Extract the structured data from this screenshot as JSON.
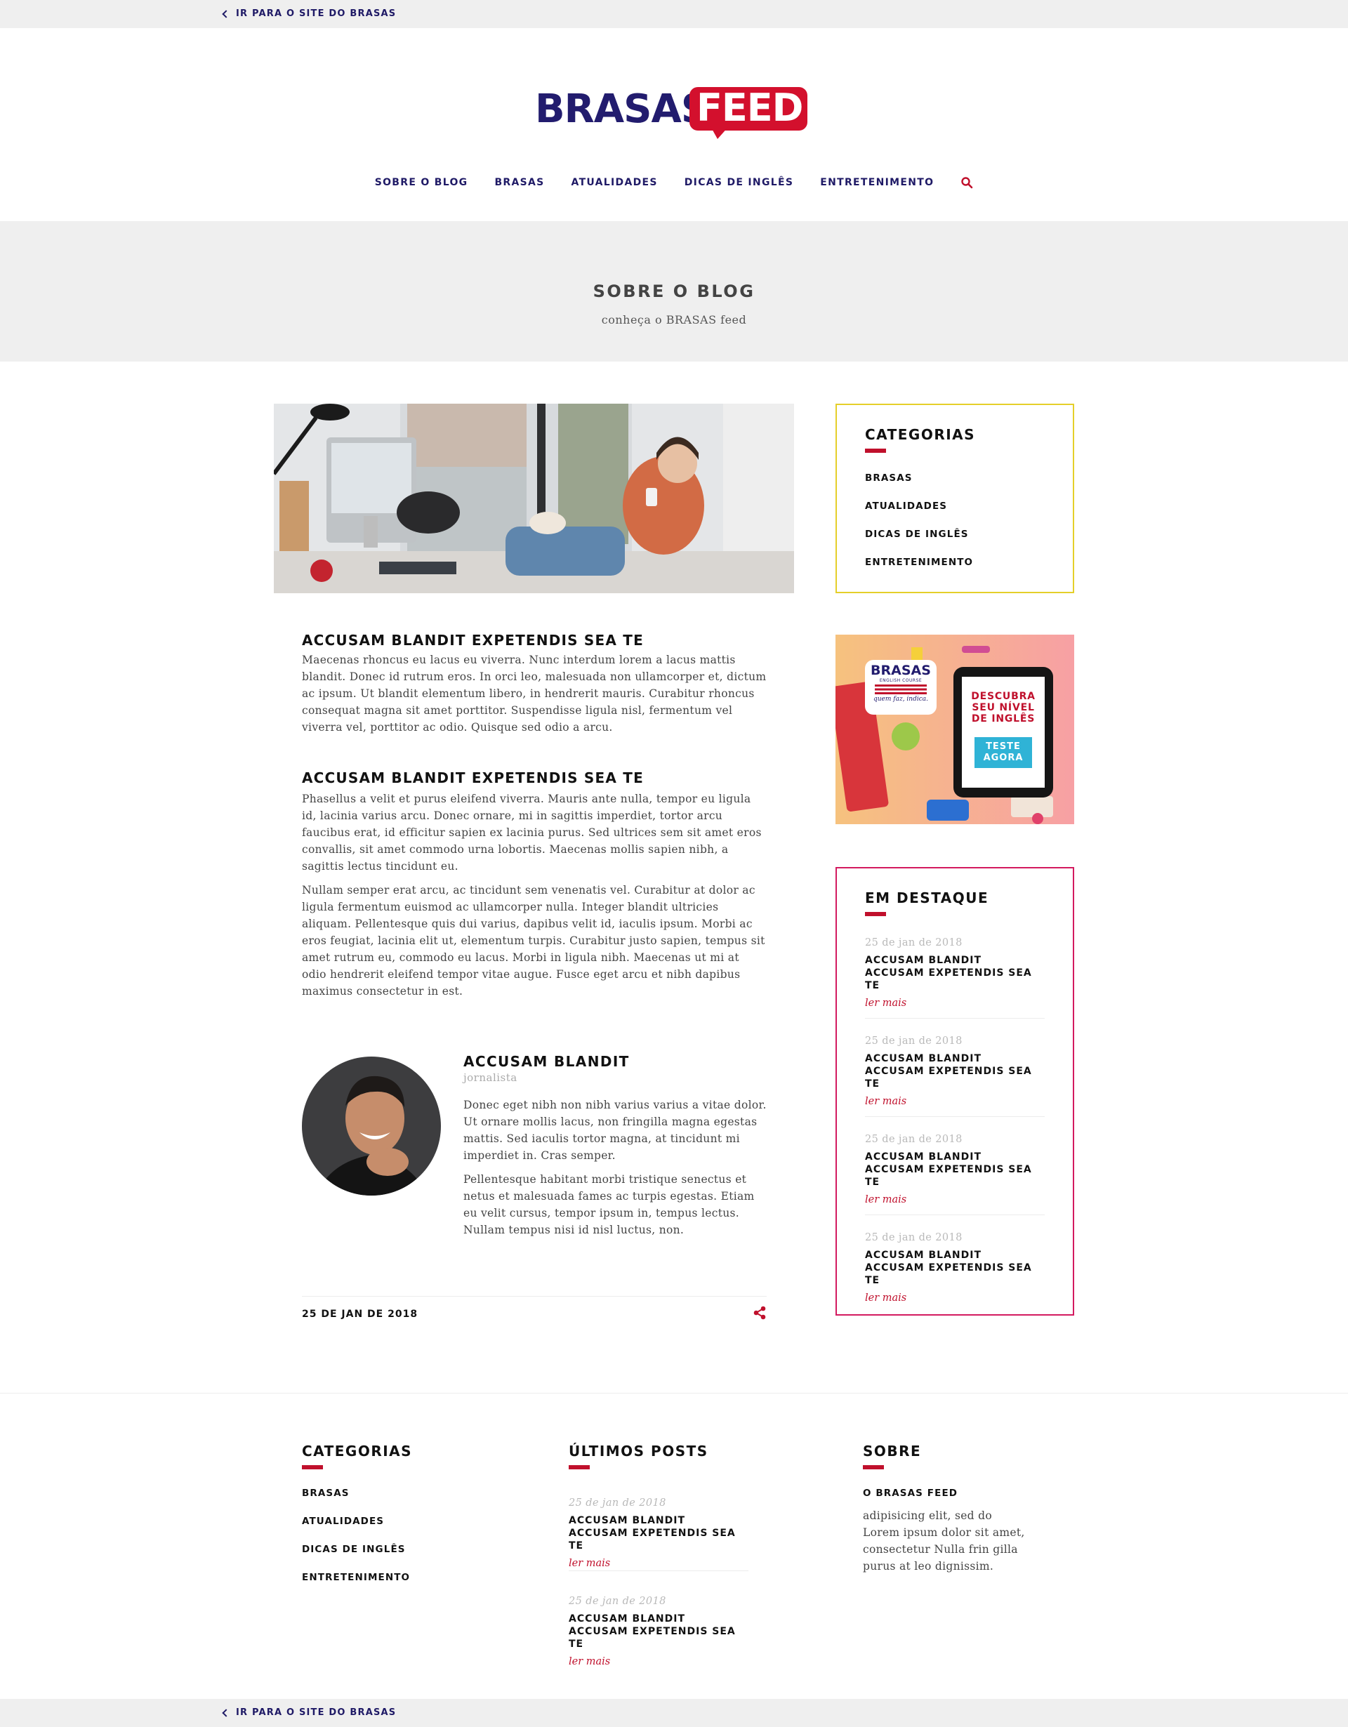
{
  "top_bar": {
    "back_label": "IR PARA O SITE DO BRASAS"
  },
  "logo": {
    "part1": "BRASAS",
    "part2": "FEED"
  },
  "nav": {
    "items": [
      "SOBRE O BLOG",
      "BRASAS",
      "ATUALIDADES",
      "DICAS DE INGLÊS",
      "ENTRETENIMENTO"
    ]
  },
  "hero": {
    "title": "SOBRE O BLOG",
    "subtitle": "conheça o BRASAS feed"
  },
  "article": {
    "sections": [
      {
        "heading": "ACCUSAM BLANDIT EXPETENDIS SEA TE",
        "paragraphs": [
          "Maecenas rhoncus eu lacus eu viverra. Nunc interdum lorem a lacus mattis blandit. Donec id rutrum eros. In orci leo, malesuada non ullamcorper et, dictum ac ipsum. Ut blandit elementum libero, in hendrerit mauris. Curabitur rhoncus consequat magna sit amet porttitor. Suspendisse ligula nisl, fermentum vel viverra vel, porttitor ac odio. Quisque sed odio a arcu."
        ]
      },
      {
        "heading": "ACCUSAM BLANDIT EXPETENDIS SEA TE",
        "paragraphs": [
          "Phasellus a velit et purus eleifend viverra. Mauris ante nulla, tempor eu ligula id, lacinia varius arcu. Donec ornare, mi in sagittis imperdiet, tortor arcu faucibus erat, id efficitur sapien ex lacinia purus. Sed ultrices sem sit amet eros convallis, sit amet commodo urna lobortis. Maecenas mollis sapien nibh, a sagittis lectus tincidunt eu.",
          "Nullam semper erat arcu, ac tincidunt sem venenatis vel. Curabitur at dolor ac ligula fermentum euismod ac ullamcorper nulla. Integer blandit ultricies aliquam. Pellentesque quis dui varius, dapibus velit id, iaculis ipsum. Morbi ac eros feugiat, lacinia elit ut, elementum turpis. Curabitur justo sapien, tempus sit amet rutrum eu, commodo eu lacus. Morbi in ligula nibh. Maecenas ut mi at odio hendrerit eleifend tempor vitae augue. Fusce eget arcu et nibh dapibus maximus consectetur in est."
        ]
      }
    ],
    "author": {
      "name": "ACCUSAM BLANDIT",
      "role": "jornalista",
      "bio": [
        "Donec eget nibh non nibh varius varius a vitae dolor. Ut ornare mollis lacus, non fringilla magna egestas mattis. Sed iaculis tortor magna, at tincidunt mi imperdiet in. Cras semper.",
        "Pellentesque habitant morbi tristique senectus et netus et malesuada fames ac turpis egestas. Etiam eu velit cursus, tempor ipsum in, tempus lectus. Nullam tempus nisi id nisl luctus, non."
      ]
    },
    "date": "25 DE JAN DE 2018"
  },
  "sidebar": {
    "categories": {
      "title": "CATEGORIAS",
      "items": [
        "BRASAS",
        "ATUALIDADES",
        "DICAS DE INGLÊS",
        "ENTRETENIMENTO"
      ]
    },
    "ad": {
      "brand": "BRASAS",
      "brand_sub": "ENGLISH COURSE",
      "brand_tagline": "quem faz, indica.",
      "headline": [
        "DESCUBRA",
        "SEU NÍVEL",
        "DE INGLÊS"
      ],
      "cta": [
        "TESTE",
        "AGORA"
      ]
    },
    "featured": {
      "title": "EM DESTAQUE",
      "items": [
        {
          "date": "25 de jan de 2018",
          "title": "ACCUSAM BLANDIT ACCUSAM EXPETENDIS SEA TE",
          "more": "ler mais"
        },
        {
          "date": "25 de jan de 2018",
          "title": "ACCUSAM BLANDIT ACCUSAM EXPETENDIS SEA TE",
          "more": "ler mais"
        },
        {
          "date": "25 de jan de 2018",
          "title": "ACCUSAM BLANDIT ACCUSAM EXPETENDIS SEA TE",
          "more": "ler mais"
        },
        {
          "date": "25 de jan de 2018",
          "title": "ACCUSAM BLANDIT ACCUSAM EXPETENDIS SEA TE",
          "more": "ler mais"
        }
      ]
    }
  },
  "footer": {
    "categories": {
      "title": "CATEGORIAS",
      "items": [
        "BRASAS",
        "ATUALIDADES",
        "DICAS DE INGLÊS",
        "ENTRETENIMENTO"
      ]
    },
    "latest": {
      "title": "ÚLTIMOS POSTS",
      "items": [
        {
          "date": "25 de jan de 2018",
          "title": "ACCUSAM BLANDIT ACCUSAM EXPETENDIS SEA TE",
          "more": "ler mais"
        },
        {
          "date": "25 de jan de 2018",
          "title": "ACCUSAM BLANDIT ACCUSAM EXPETENDIS SEA TE",
          "more": "ler mais"
        }
      ]
    },
    "about": {
      "title": "SOBRE",
      "subtitle": "O BRASAS FEED",
      "text": "adipisicing elit, sed do Lorem ipsum dolor sit amet, consectetur Nulla frin gilla purus at leo dignissim."
    }
  },
  "bottom_bar": {
    "back_label": "IR PARA O SITE DO BRASAS"
  },
  "colors": {
    "navy": "#1f1a66",
    "red": "#c0102c",
    "yellow_border": "#e5cf2a",
    "magenta_border": "#d31a5f",
    "light_gray": "#efefef"
  }
}
